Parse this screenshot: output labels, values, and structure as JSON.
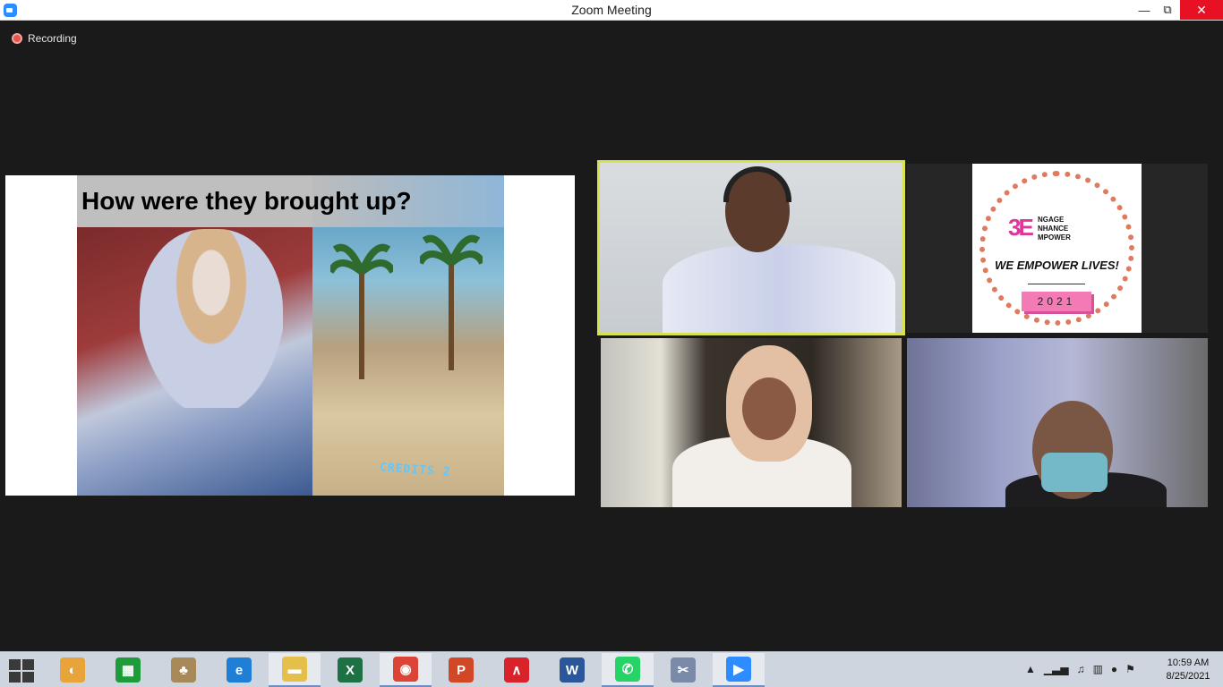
{
  "window": {
    "title": "Zoom Meeting",
    "minimize": "—",
    "restore": "⧉",
    "close": "✕"
  },
  "recording": {
    "label": "Recording"
  },
  "shared_screen": {
    "slide_title": "How were they brought up?",
    "game_text": "CREDITS 2"
  },
  "logo": {
    "mark": "3E",
    "words": [
      "NGAGE",
      "NHANCE",
      "MPOWER"
    ],
    "tagline": "WE EMPOWER LIVES!",
    "year": "2021",
    "accent": "#e0359a"
  },
  "active_speaker_color": "#d8e24a",
  "taskbar": {
    "apps": [
      {
        "name": "paint-app-icon",
        "glyph": "◐",
        "color": "#e8a33a"
      },
      {
        "name": "store-app-icon",
        "glyph": "▦",
        "color": "#1f9c3a"
      },
      {
        "name": "mahjong-app-icon",
        "glyph": "♣",
        "color": "#a88a5a"
      },
      {
        "name": "internet-explorer-icon",
        "glyph": "e",
        "color": "#1f7fd6"
      },
      {
        "name": "file-explorer-icon",
        "glyph": "▬",
        "color": "#e4c04a"
      },
      {
        "name": "excel-icon",
        "glyph": "X",
        "color": "#1e7145"
      },
      {
        "name": "chrome-icon",
        "glyph": "◉",
        "color": "#db4437"
      },
      {
        "name": "powerpoint-icon",
        "glyph": "P",
        "color": "#d24726"
      },
      {
        "name": "acrobat-icon",
        "glyph": "∧",
        "color": "#d8232a"
      },
      {
        "name": "word-icon",
        "glyph": "W",
        "color": "#2b579a"
      },
      {
        "name": "whatsapp-icon",
        "glyph": "✆",
        "color": "#25d366"
      },
      {
        "name": "snipping-tool-icon",
        "glyph": "✂",
        "color": "#7a8aa8"
      },
      {
        "name": "zoom-icon",
        "glyph": "▶",
        "color": "#2d8cff"
      }
    ],
    "tray": [
      "▲",
      "▁▃▅",
      "♫",
      "▥",
      "●",
      "⚑"
    ],
    "time": "10:59 AM",
    "date": "8/25/2021"
  }
}
